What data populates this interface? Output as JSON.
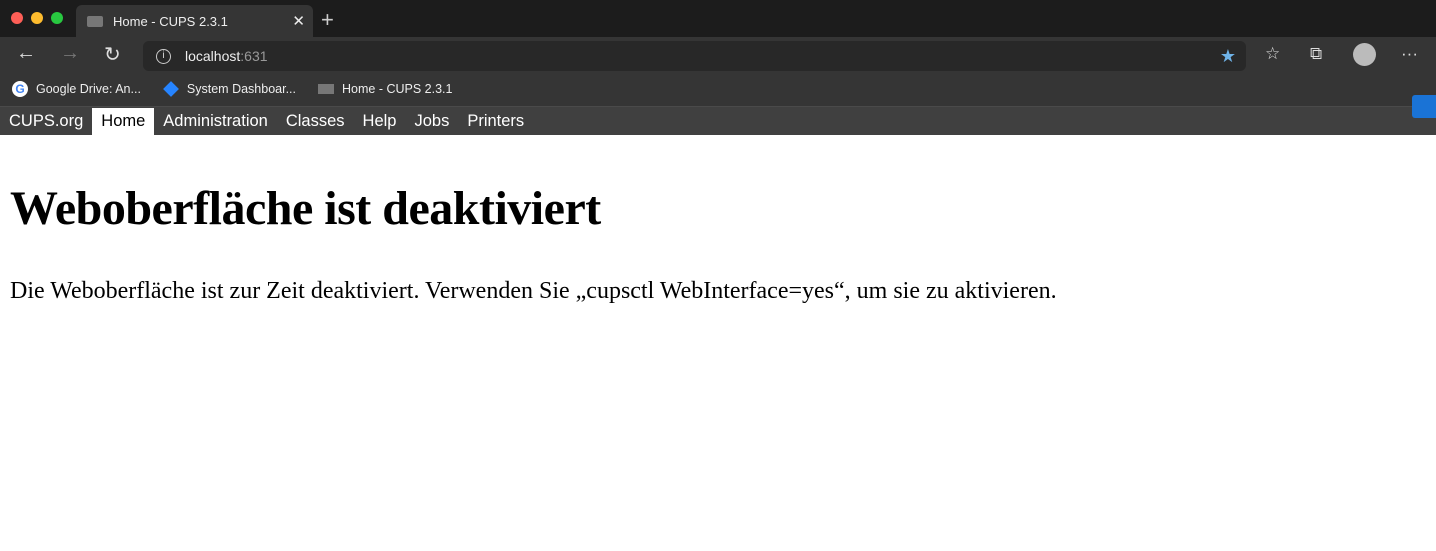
{
  "browser": {
    "tab_title": "Home - CUPS 2.3.1",
    "url_host": "localhost",
    "url_port": ":631",
    "bookmarks": [
      {
        "label": "Google Drive: An...",
        "icon": "google-icon"
      },
      {
        "label": "System Dashboar...",
        "icon": "jira-icon"
      },
      {
        "label": "Home - CUPS 2.3.1",
        "icon": "cups-icon"
      }
    ]
  },
  "nav": {
    "items": [
      "CUPS.org",
      "Home",
      "Administration",
      "Classes",
      "Help",
      "Jobs",
      "Printers"
    ],
    "active": "Home"
  },
  "page": {
    "title": "Weboberfläche ist deaktiviert",
    "message": "Die Weboberfläche ist zur Zeit deaktiviert. Verwenden Sie „cupsctl WebInterface=yes“, um sie zu aktivieren."
  },
  "colors": {
    "nav_bg": "#404040",
    "star": "#6fb3e8"
  }
}
